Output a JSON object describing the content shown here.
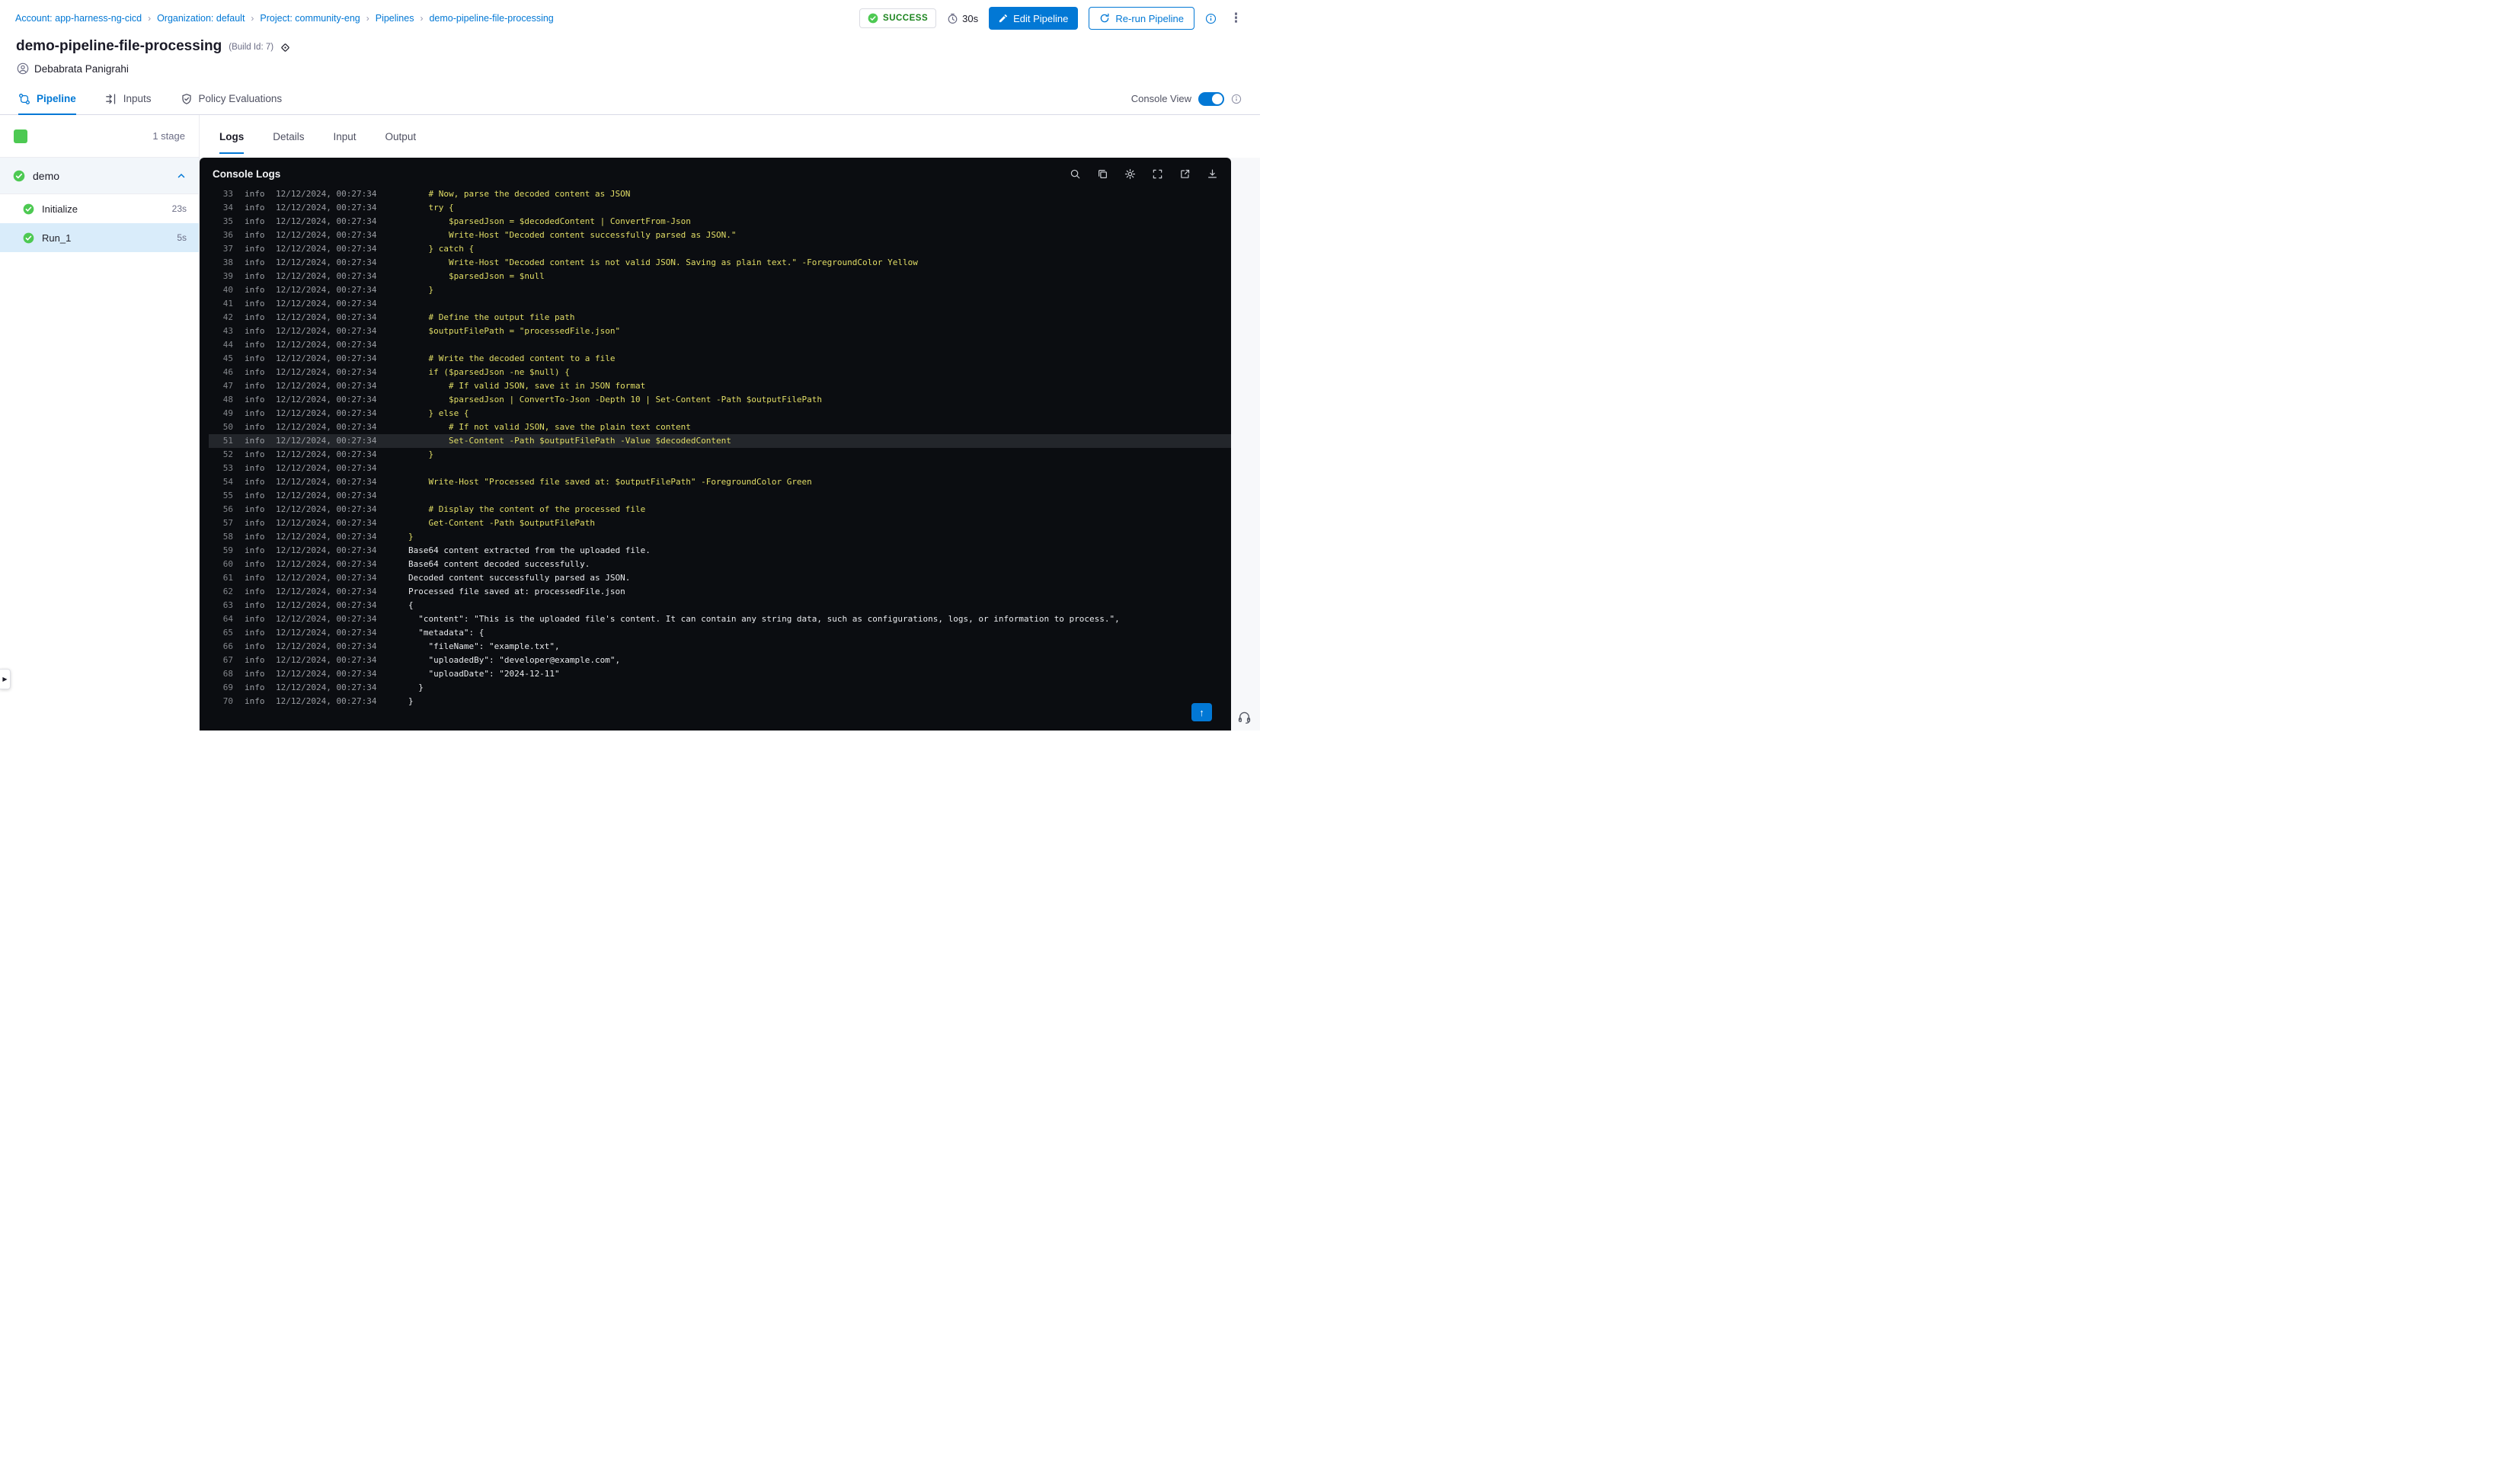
{
  "breadcrumb": {
    "separator": "›",
    "items": [
      "Account: app-harness-ng-cicd",
      "Organization: default",
      "Project: community-eng",
      "Pipelines",
      "demo-pipeline-file-processing"
    ]
  },
  "header": {
    "status": "SUCCESS",
    "duration": "30s",
    "edit_button": "Edit Pipeline",
    "rerun_button": "Re-run Pipeline",
    "title": "demo-pipeline-file-processing",
    "build_id": "(Build Id: 7)",
    "user": "Debabrata Panigrahi"
  },
  "nav_tabs": {
    "items": [
      {
        "label": "Pipeline"
      },
      {
        "label": "Inputs"
      },
      {
        "label": "Policy Evaluations"
      }
    ],
    "active": "Pipeline",
    "console_view_label": "Console View",
    "console_view_on": true
  },
  "sidebar": {
    "stage_count_label": "1 stage",
    "group": {
      "name": "demo",
      "status": "success"
    },
    "steps": [
      {
        "name": "Initialize",
        "duration": "23s",
        "selected": false,
        "status": "success"
      },
      {
        "name": "Run_1",
        "duration": "5s",
        "selected": true,
        "status": "success"
      }
    ]
  },
  "log_tabs": {
    "items": [
      "Logs",
      "Details",
      "Input",
      "Output"
    ],
    "active": "Logs"
  },
  "console": {
    "title": "Console Logs",
    "toolbar_icons": [
      "search",
      "copy",
      "settings",
      "fullscreen",
      "open-in-new",
      "download"
    ],
    "highlight_line": 51,
    "lines": [
      {
        "n": 33,
        "level": "info",
        "ts": "12/12/2024, 00:27:34",
        "kind": "script",
        "text": "    # Now, parse the decoded content as JSON"
      },
      {
        "n": 34,
        "level": "info",
        "ts": "12/12/2024, 00:27:34",
        "kind": "script",
        "text": "    try {"
      },
      {
        "n": 35,
        "level": "info",
        "ts": "12/12/2024, 00:27:34",
        "kind": "script",
        "text": "        $parsedJson = $decodedContent | ConvertFrom-Json"
      },
      {
        "n": 36,
        "level": "info",
        "ts": "12/12/2024, 00:27:34",
        "kind": "script",
        "text": "        Write-Host \"Decoded content successfully parsed as JSON.\""
      },
      {
        "n": 37,
        "level": "info",
        "ts": "12/12/2024, 00:27:34",
        "kind": "script",
        "text": "    } catch {"
      },
      {
        "n": 38,
        "level": "info",
        "ts": "12/12/2024, 00:27:34",
        "kind": "script",
        "text": "        Write-Host \"Decoded content is not valid JSON. Saving as plain text.\" -ForegroundColor Yellow"
      },
      {
        "n": 39,
        "level": "info",
        "ts": "12/12/2024, 00:27:34",
        "kind": "script",
        "text": "        $parsedJson = $null"
      },
      {
        "n": 40,
        "level": "info",
        "ts": "12/12/2024, 00:27:34",
        "kind": "script",
        "text": "    }"
      },
      {
        "n": 41,
        "level": "info",
        "ts": "12/12/2024, 00:27:34",
        "kind": "script",
        "text": ""
      },
      {
        "n": 42,
        "level": "info",
        "ts": "12/12/2024, 00:27:34",
        "kind": "script",
        "text": "    # Define the output file path"
      },
      {
        "n": 43,
        "level": "info",
        "ts": "12/12/2024, 00:27:34",
        "kind": "script",
        "text": "    $outputFilePath = \"processedFile.json\""
      },
      {
        "n": 44,
        "level": "info",
        "ts": "12/12/2024, 00:27:34",
        "kind": "script",
        "text": ""
      },
      {
        "n": 45,
        "level": "info",
        "ts": "12/12/2024, 00:27:34",
        "kind": "script",
        "text": "    # Write the decoded content to a file"
      },
      {
        "n": 46,
        "level": "info",
        "ts": "12/12/2024, 00:27:34",
        "kind": "script",
        "text": "    if ($parsedJson -ne $null) {"
      },
      {
        "n": 47,
        "level": "info",
        "ts": "12/12/2024, 00:27:34",
        "kind": "script",
        "text": "        # If valid JSON, save it in JSON format"
      },
      {
        "n": 48,
        "level": "info",
        "ts": "12/12/2024, 00:27:34",
        "kind": "script",
        "text": "        $parsedJson | ConvertTo-Json -Depth 10 | Set-Content -Path $outputFilePath"
      },
      {
        "n": 49,
        "level": "info",
        "ts": "12/12/2024, 00:27:34",
        "kind": "script",
        "text": "    } else {"
      },
      {
        "n": 50,
        "level": "info",
        "ts": "12/12/2024, 00:27:34",
        "kind": "script",
        "text": "        # If not valid JSON, save the plain text content"
      },
      {
        "n": 51,
        "level": "info",
        "ts": "12/12/2024, 00:27:34",
        "kind": "script",
        "text": "        Set-Content -Path $outputFilePath -Value $decodedContent"
      },
      {
        "n": 52,
        "level": "info",
        "ts": "12/12/2024, 00:27:34",
        "kind": "script",
        "text": "    }"
      },
      {
        "n": 53,
        "level": "info",
        "ts": "12/12/2024, 00:27:34",
        "kind": "script",
        "text": ""
      },
      {
        "n": 54,
        "level": "info",
        "ts": "12/12/2024, 00:27:34",
        "kind": "script",
        "text": "    Write-Host \"Processed file saved at: $outputFilePath\" -ForegroundColor Green"
      },
      {
        "n": 55,
        "level": "info",
        "ts": "12/12/2024, 00:27:34",
        "kind": "script",
        "text": ""
      },
      {
        "n": 56,
        "level": "info",
        "ts": "12/12/2024, 00:27:34",
        "kind": "script",
        "text": "    # Display the content of the processed file"
      },
      {
        "n": 57,
        "level": "info",
        "ts": "12/12/2024, 00:27:34",
        "kind": "script",
        "text": "    Get-Content -Path $outputFilePath"
      },
      {
        "n": 58,
        "level": "info",
        "ts": "12/12/2024, 00:27:34",
        "kind": "script",
        "text": "}"
      },
      {
        "n": 59,
        "level": "info",
        "ts": "12/12/2024, 00:27:34",
        "kind": "output",
        "text": "Base64 content extracted from the uploaded file."
      },
      {
        "n": 60,
        "level": "info",
        "ts": "12/12/2024, 00:27:34",
        "kind": "output",
        "text": "Base64 content decoded successfully."
      },
      {
        "n": 61,
        "level": "info",
        "ts": "12/12/2024, 00:27:34",
        "kind": "output",
        "text": "Decoded content successfully parsed as JSON."
      },
      {
        "n": 62,
        "level": "info",
        "ts": "12/12/2024, 00:27:34",
        "kind": "output",
        "text": "Processed file saved at: processedFile.json"
      },
      {
        "n": 63,
        "level": "info",
        "ts": "12/12/2024, 00:27:34",
        "kind": "output",
        "text": "{"
      },
      {
        "n": 64,
        "level": "info",
        "ts": "12/12/2024, 00:27:34",
        "kind": "output",
        "text": "  \"content\": \"This is the uploaded file's content. It can contain any string data, such as configurations, logs, or information to process.\","
      },
      {
        "n": 65,
        "level": "info",
        "ts": "12/12/2024, 00:27:34",
        "kind": "output",
        "text": "  \"metadata\": {"
      },
      {
        "n": 66,
        "level": "info",
        "ts": "12/12/2024, 00:27:34",
        "kind": "output",
        "text": "    \"fileName\": \"example.txt\","
      },
      {
        "n": 67,
        "level": "info",
        "ts": "12/12/2024, 00:27:34",
        "kind": "output",
        "text": "    \"uploadedBy\": \"developer@example.com\","
      },
      {
        "n": 68,
        "level": "info",
        "ts": "12/12/2024, 00:27:34",
        "kind": "output",
        "text": "    \"uploadDate\": \"2024-12-11\""
      },
      {
        "n": 69,
        "level": "info",
        "ts": "12/12/2024, 00:27:34",
        "kind": "output",
        "text": "  }"
      },
      {
        "n": 70,
        "level": "info",
        "ts": "12/12/2024, 00:27:34",
        "kind": "output",
        "text": "}"
      }
    ]
  },
  "icons": {
    "kebab": "⋮",
    "scroll_top": "↑",
    "collapse_handle": "▶"
  },
  "colors": {
    "accent": "#0278d5",
    "success_green": "#4dc952",
    "success_text": "#1b841d",
    "console_background": "#0b0d11",
    "script_line": "#e2de66",
    "output_line": "#e9ebee",
    "selected_step_background": "#d9ecfa"
  }
}
